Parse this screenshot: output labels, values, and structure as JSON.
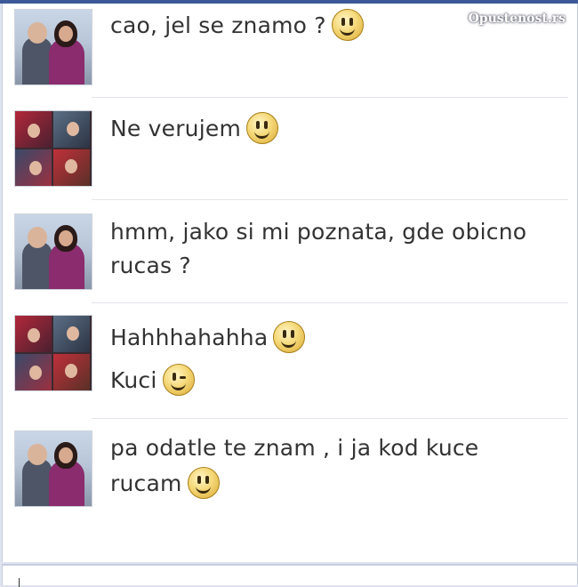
{
  "watermark": "Opustenost.rs",
  "messages": [
    {
      "sender": "male",
      "lines": [
        "cao, jel se znamo ?"
      ],
      "emoji": "smile"
    },
    {
      "sender": "female",
      "lines": [
        "Ne verujem"
      ],
      "emoji": "smile"
    },
    {
      "sender": "male",
      "lines": [
        "hmm, jako si mi poznata, gde obicno",
        "rucas ?"
      ],
      "emoji": ""
    },
    {
      "sender": "female",
      "lines": [
        "Hahhhahahha",
        "Kuci"
      ],
      "emoji": "smile"
    },
    {
      "sender": "male",
      "lines": [
        "pa odatle te znam , i ja kod kuce",
        "rucam"
      ],
      "emoji": "smile"
    }
  ],
  "icons": {
    "smile": "smiley-icon",
    "wink": "wink-icon",
    "avatar_male": "couple-photo",
    "avatar_female": "collage-photo"
  },
  "colors": {
    "header": "#3b5998",
    "text": "#333333",
    "divider": "#e2e5ec"
  },
  "input": {
    "value": ""
  }
}
